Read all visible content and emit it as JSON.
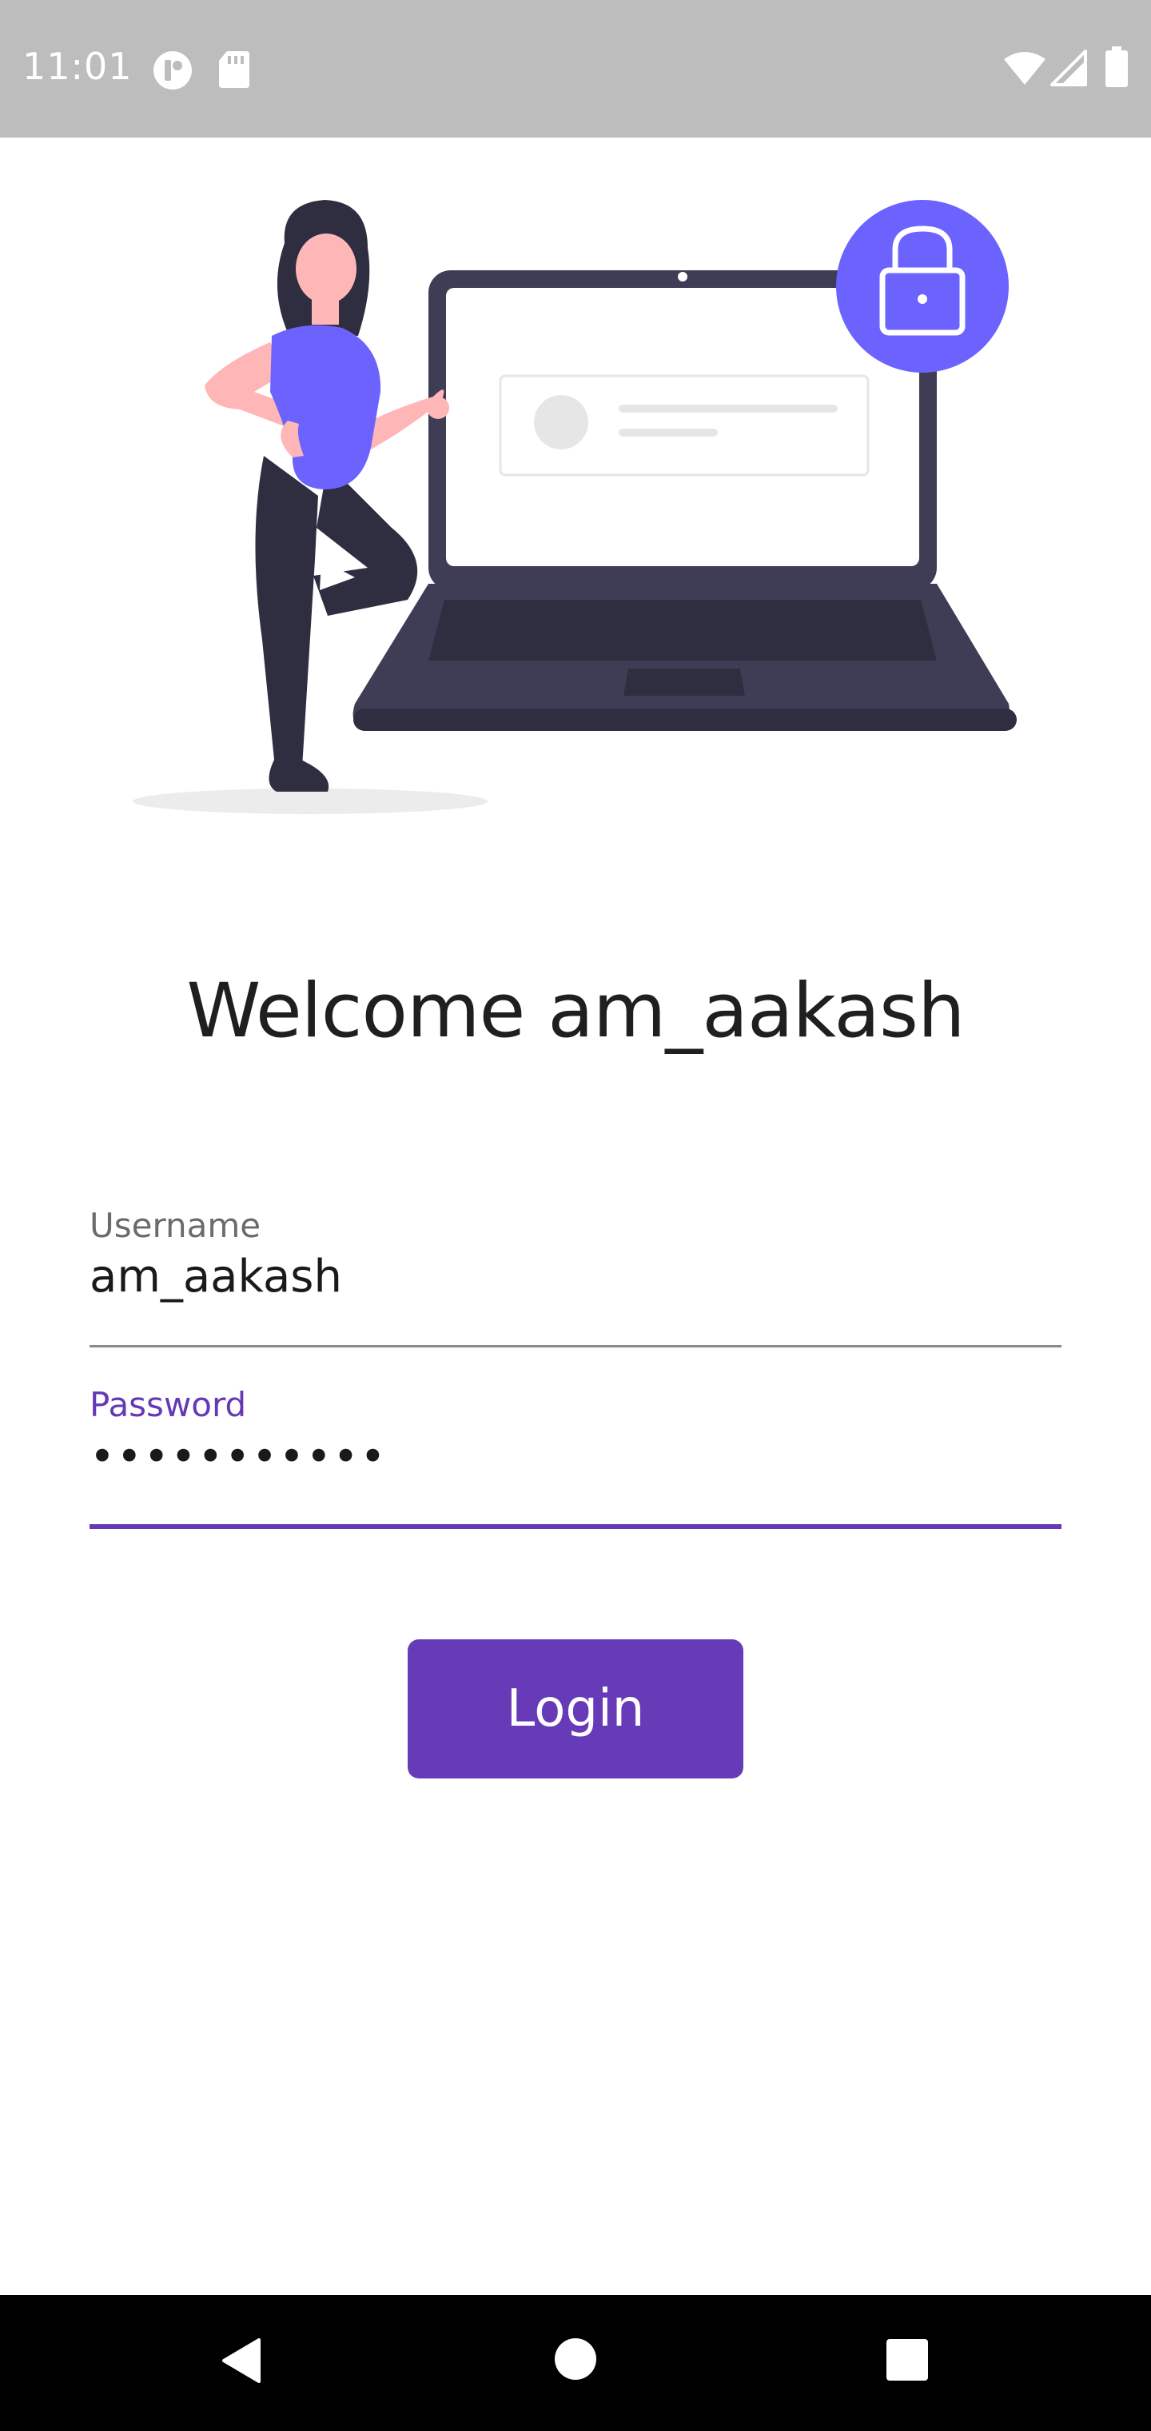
{
  "status_bar": {
    "time": "11:01",
    "icons": [
      "sync-icon",
      "sd-card-icon",
      "wifi-icon",
      "cellular-signal-icon",
      "battery-icon"
    ]
  },
  "illustration": {
    "name": "secure-login-illustration",
    "colors": {
      "accent": "#6c63ff",
      "laptop": "#3f3d56",
      "dark": "#2f2e41",
      "skin": "#ffb6b6"
    }
  },
  "welcome": {
    "title": "Welcome am_aakash"
  },
  "form": {
    "username": {
      "label": "Username",
      "value": "am_aakash"
    },
    "password": {
      "label": "Password",
      "value": "•••••••••••"
    },
    "login_label": "Login"
  },
  "nav_bar": {
    "buttons": [
      "back-icon",
      "home-icon",
      "recents-icon"
    ]
  },
  "colors": {
    "primary": "#673ab7",
    "status_bar": "#bdbdbd",
    "nav_bar": "#000000"
  }
}
